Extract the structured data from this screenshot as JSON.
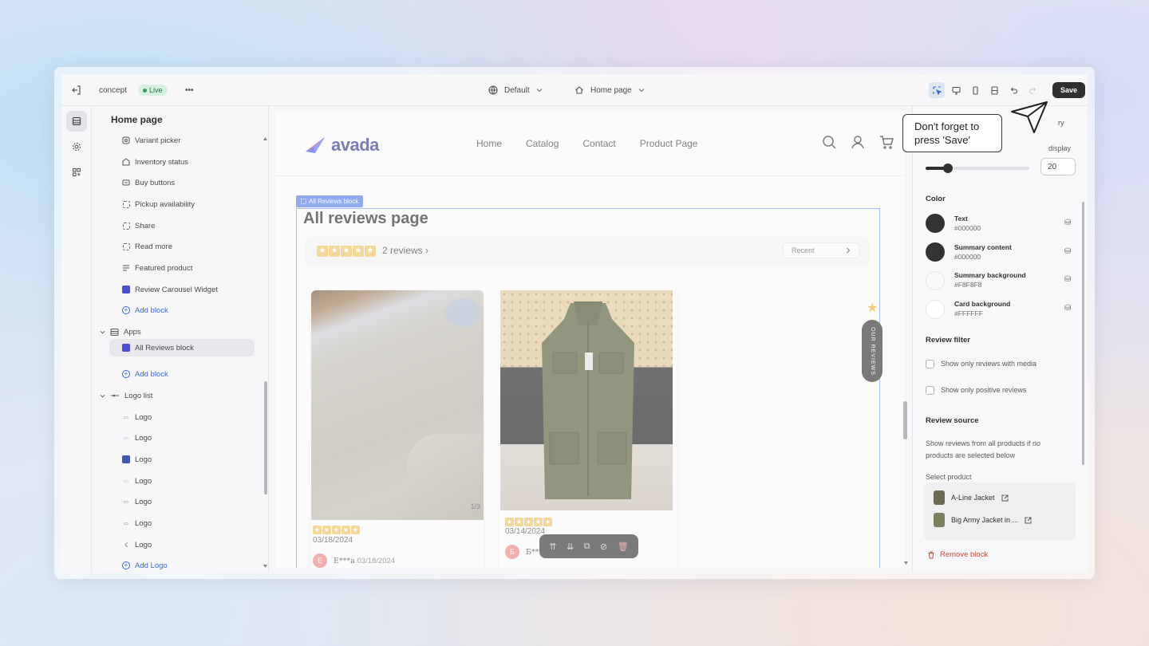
{
  "topbar": {
    "store_name": "concept",
    "live_label": "Live",
    "more": "•••",
    "theme_select": "Default",
    "page_select": "Home page",
    "save_label": "Save"
  },
  "sidebar": {
    "title": "Home page",
    "items": [
      {
        "label": "Variant picker",
        "icon": "variant-icon"
      },
      {
        "label": "Inventory status",
        "icon": "inventory-icon"
      },
      {
        "label": "Buy buttons",
        "icon": "buy-icon"
      },
      {
        "label": "Pickup availability",
        "icon": "dashed-square-icon"
      },
      {
        "label": "Share",
        "icon": "dashed-square-icon"
      },
      {
        "label": "Read more",
        "icon": "dashed-square-icon"
      },
      {
        "label": "Featured product",
        "icon": "list-icon"
      },
      {
        "label": "Review Carousel Widget",
        "icon": "app-block-icon"
      },
      {
        "label": "Add block",
        "icon": "plus-circle-icon"
      }
    ],
    "apps_group": "Apps",
    "apps_items": [
      {
        "label": "All Reviews block",
        "icon": "app-block-icon"
      },
      {
        "label": "Add block",
        "icon": "plus-circle-icon"
      }
    ],
    "logo_group": "Logo list",
    "logo_items": [
      "Logo",
      "Logo",
      "Logo",
      "Logo",
      "Logo",
      "Logo",
      "Logo"
    ],
    "add_logo": "Add Logo"
  },
  "store": {
    "logo_text": "avada",
    "nav": [
      "Home",
      "Catalog",
      "Contact",
      "Product Page"
    ],
    "block_tag": "All Reviews block",
    "page_heading": "All reviews page",
    "summary_count": "2 reviews",
    "sort_select": "Recent",
    "reviews": [
      {
        "date": "03/18/2024",
        "avatar": "E",
        "author": "E***a",
        "author_date": "03/18/2024",
        "pager": "1/3",
        "rating": 5
      },
      {
        "date": "03/14/2024",
        "avatar": "Б",
        "author": "Б**",
        "rating": 5
      }
    ],
    "side_tab": "OUR REVIEWS"
  },
  "settings": {
    "partial_top": "ry",
    "partial_display": "display",
    "slider_value": "20",
    "slider_level": 0.1,
    "color_heading": "Color",
    "colors": [
      {
        "name": "Text",
        "hex": "#000000",
        "swatch": "#333333"
      },
      {
        "name": "Summary content",
        "hex": "#000000",
        "swatch": "#333333"
      },
      {
        "name": "Summary background",
        "hex": "#F8F8F8",
        "swatch": "#F8F8F8"
      },
      {
        "name": "Card background",
        "hex": "#FFFFFF",
        "swatch": "#FFFFFF"
      }
    ],
    "filter_heading": "Review filter",
    "filter_options": [
      "Show only reviews with media",
      "Show only positive reviews"
    ],
    "source_heading": "Review source",
    "source_help": "Show reviews from all products if no products are selected below",
    "select_product": "Select product",
    "products": [
      "A-Line Jacket",
      "Big Army Jacket in ..."
    ],
    "remove_block": "Remove block"
  },
  "tooltip": {
    "line1": "Don't forget to",
    "line2": "press 'Save'"
  }
}
